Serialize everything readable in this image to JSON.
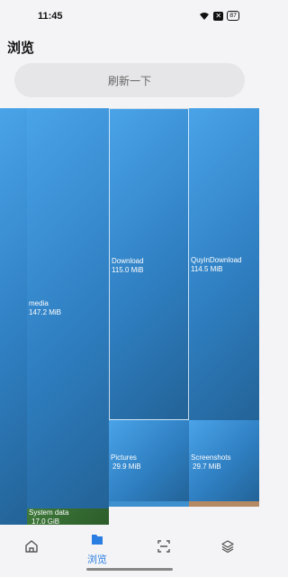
{
  "status": {
    "time": "11:45",
    "battery": "87",
    "icons": [
      "wifi-icon",
      "notification-x-icon",
      "battery-icon"
    ]
  },
  "page": {
    "title": "浏览"
  },
  "refresh": {
    "label": "刷新一下"
  },
  "treemap": {
    "tiles": [
      {
        "name": "media",
        "size": "147.2 MiB"
      },
      {
        "name": "Download",
        "size": "115.0 MiB"
      },
      {
        "name": "QuyinDownload",
        "size": "114.5 MiB"
      },
      {
        "name": "Pictures",
        "size": "29.9 MiB"
      },
      {
        "name": "Screenshots",
        "size": "29.7 MiB"
      },
      {
        "name": "System data",
        "size": "17.0 GiB"
      }
    ]
  },
  "nav": {
    "active_label": "浏览",
    "items": [
      "home-icon",
      "folder-icon",
      "scan-icon",
      "layers-icon"
    ]
  },
  "colors": {
    "accent": "#2a7de1",
    "tile_blue": "#2f7fc2",
    "system_green": "#2c5c2a"
  }
}
